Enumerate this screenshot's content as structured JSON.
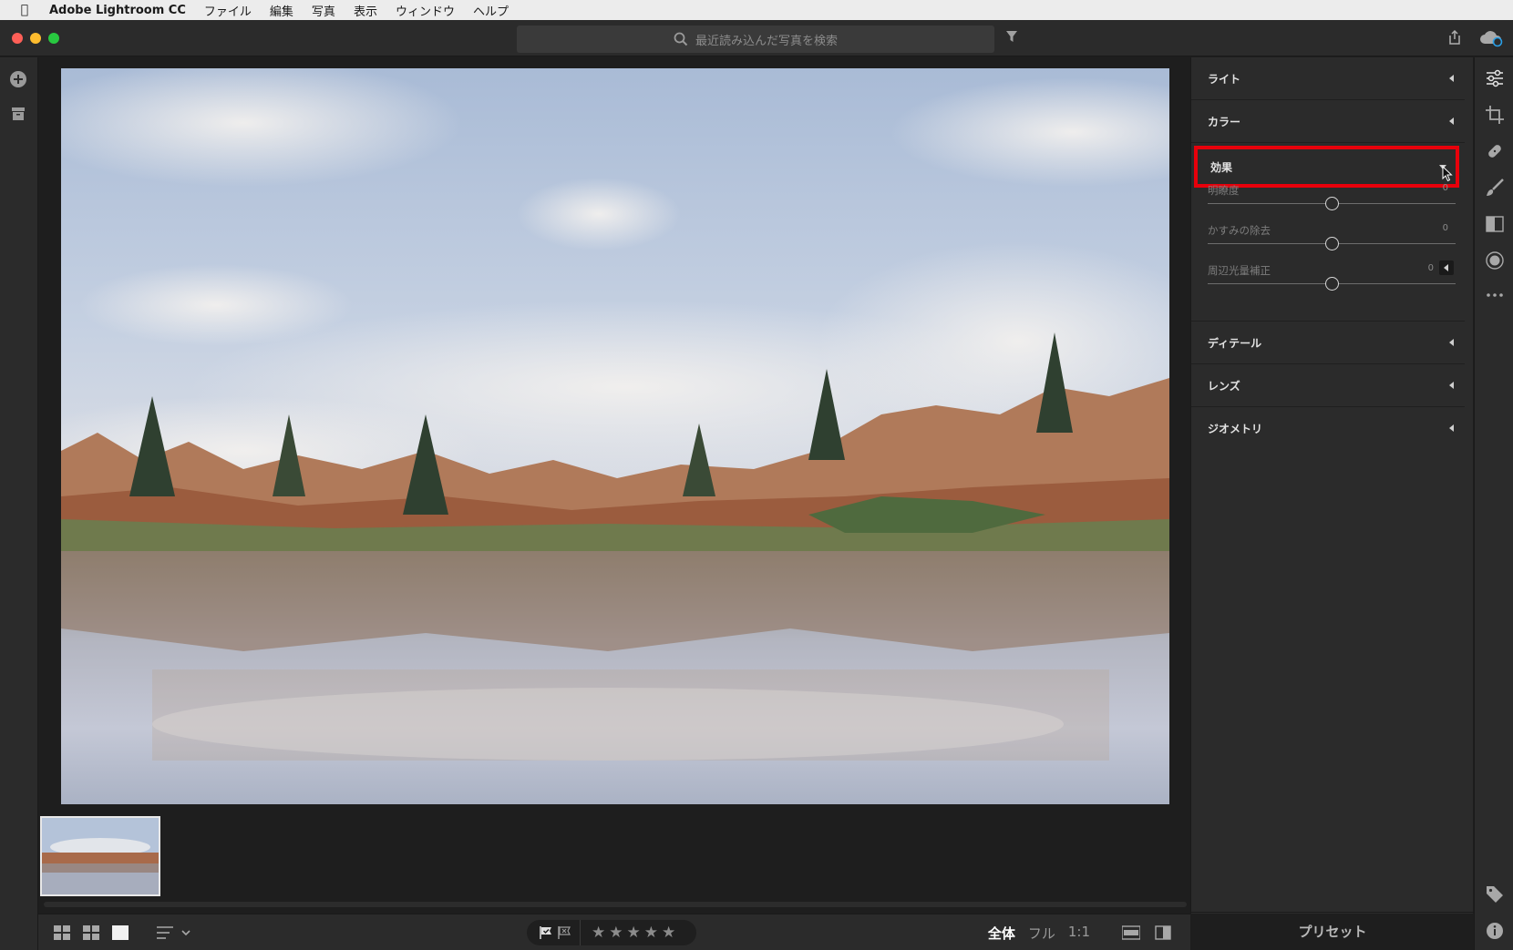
{
  "menubar": {
    "app_name": "Adobe Lightroom CC",
    "items": [
      "ファイル",
      "編集",
      "写真",
      "表示",
      "ウィンドウ",
      "ヘルプ"
    ]
  },
  "search": {
    "placeholder": "最近読み込んだ写真を検索"
  },
  "edit_panel": {
    "sections": [
      {
        "label": "ライト",
        "expanded": false
      },
      {
        "label": "カラー",
        "expanded": false
      },
      {
        "label": "効果",
        "expanded": true,
        "highlighted": true
      },
      {
        "label": "ディテール",
        "expanded": false
      },
      {
        "label": "レンズ",
        "expanded": false
      },
      {
        "label": "ジオメトリ",
        "expanded": false
      }
    ],
    "effects_sliders": [
      {
        "label": "明瞭度",
        "value": "0",
        "position": 0.5
      },
      {
        "label": "かすみの除去",
        "value": "0",
        "position": 0.5
      },
      {
        "label": "周辺光量補正",
        "value": "0",
        "position": 0.5
      }
    ],
    "presets_label": "プリセット"
  },
  "bottom_bar": {
    "zoom_options": [
      "全体",
      "フル",
      "1:1"
    ],
    "active_zoom": "全体",
    "stars": [
      "★",
      "★",
      "★",
      "★",
      "★"
    ]
  },
  "colors": {
    "highlight": "#e8000b",
    "panel_bg": "#2b2b2b",
    "main_bg": "#1e1e1e"
  }
}
